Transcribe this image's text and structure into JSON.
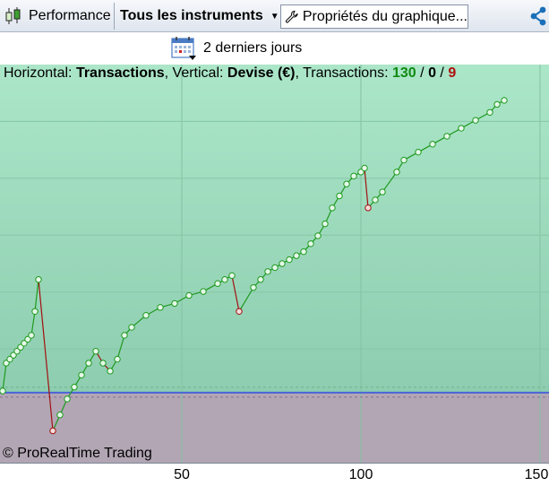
{
  "toolbar": {
    "performance_label": "Performance",
    "instruments_label": "Tous les instruments",
    "properties_label": "Propriétés du graphique..."
  },
  "period": {
    "label": "2 derniers jours"
  },
  "chart_info": {
    "horizontal_prefix": "Horizontal:",
    "horizontal_value": "Transactions",
    "vertical_prefix": ", Vertical:",
    "vertical_value": "Devise (€)",
    "transactions_prefix": ", Transactions:",
    "winning": "130",
    "neutral": "0",
    "losing": "9",
    "sep": "/"
  },
  "copyright": "© ProRealTime Trading",
  "colors": {
    "profit_zone": "#9fdbbe",
    "loss_zone": "#b2a6b4",
    "up_line": "#1e9a1e",
    "down_line": "#a01010",
    "zero_line": "#4a64d8"
  },
  "chart_data": {
    "type": "line",
    "x_ticks": [
      50,
      100,
      150
    ],
    "xlim": [
      0,
      153
    ],
    "grid": true,
    "zero_level_fraction": 0.824,
    "points": [
      [
        0,
        0.82
      ],
      [
        1,
        0.75
      ],
      [
        2,
        0.74
      ],
      [
        3,
        0.73
      ],
      [
        4,
        0.72
      ],
      [
        5,
        0.71
      ],
      [
        6,
        0.7
      ],
      [
        7,
        0.69
      ],
      [
        8,
        0.68
      ],
      [
        9,
        0.62
      ],
      [
        10,
        0.54
      ],
      [
        14,
        0.92
      ],
      [
        16,
        0.88
      ],
      [
        18,
        0.84
      ],
      [
        20,
        0.81
      ],
      [
        22,
        0.78
      ],
      [
        24,
        0.75
      ],
      [
        26,
        0.72
      ],
      [
        28,
        0.75
      ],
      [
        30,
        0.77
      ],
      [
        32,
        0.74
      ],
      [
        34,
        0.68
      ],
      [
        36,
        0.66
      ],
      [
        40,
        0.63
      ],
      [
        44,
        0.61
      ],
      [
        48,
        0.6
      ],
      [
        52,
        0.58
      ],
      [
        56,
        0.57
      ],
      [
        60,
        0.55
      ],
      [
        62,
        0.54
      ],
      [
        64,
        0.53
      ],
      [
        66,
        0.62
      ],
      [
        70,
        0.56
      ],
      [
        72,
        0.54
      ],
      [
        74,
        0.52
      ],
      [
        76,
        0.51
      ],
      [
        78,
        0.5
      ],
      [
        80,
        0.49
      ],
      [
        82,
        0.48
      ],
      [
        84,
        0.47
      ],
      [
        86,
        0.45
      ],
      [
        88,
        0.43
      ],
      [
        90,
        0.4
      ],
      [
        92,
        0.36
      ],
      [
        94,
        0.33
      ],
      [
        96,
        0.3
      ],
      [
        98,
        0.28
      ],
      [
        100,
        0.27
      ],
      [
        101,
        0.26
      ],
      [
        102,
        0.36
      ],
      [
        104,
        0.34
      ],
      [
        106,
        0.32
      ],
      [
        110,
        0.27
      ],
      [
        112,
        0.24
      ],
      [
        116,
        0.22
      ],
      [
        120,
        0.2
      ],
      [
        124,
        0.18
      ],
      [
        128,
        0.16
      ],
      [
        132,
        0.14
      ],
      [
        136,
        0.12
      ],
      [
        138,
        0.1
      ],
      [
        140,
        0.09
      ]
    ]
  }
}
